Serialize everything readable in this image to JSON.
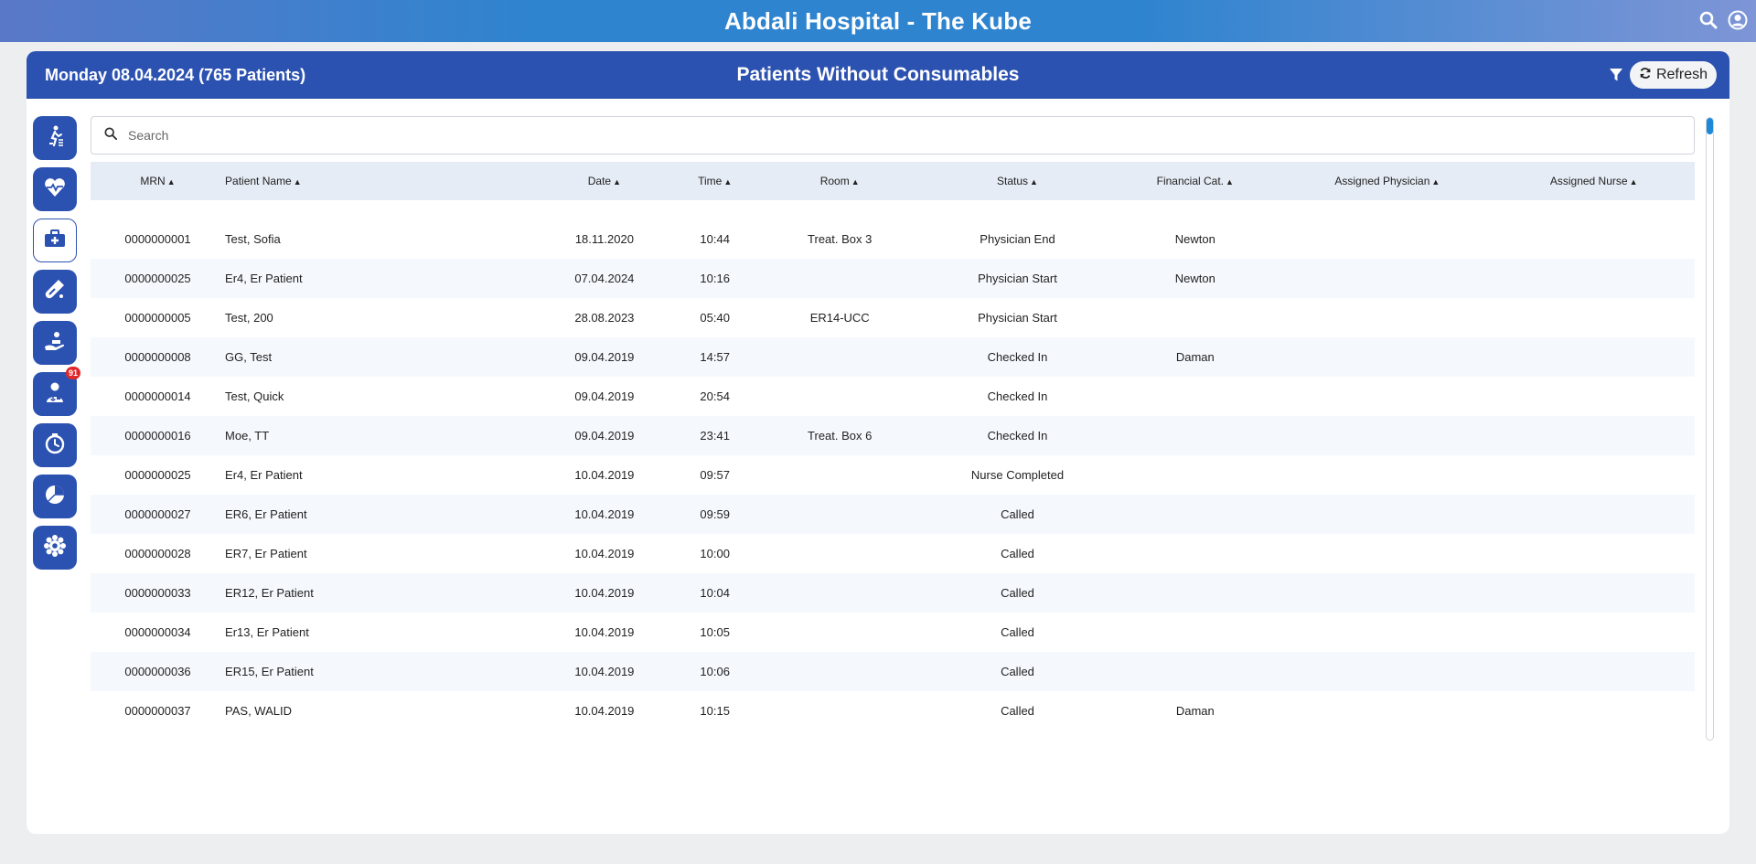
{
  "app": {
    "title": "Abdali Hospital - The Kube",
    "top_icons": [
      "search-icon",
      "user-account-icon"
    ]
  },
  "header": {
    "date_info": "Monday 08.04.2024 (765 Patients)",
    "page_title": "Patients Without Consumables",
    "refresh_label": "Refresh"
  },
  "sidebar": {
    "items": [
      {
        "icon": "patient-walking-icon"
      },
      {
        "icon": "heart-monitor-icon"
      },
      {
        "icon": "medical-kit-icon",
        "active": true
      },
      {
        "icon": "lab-test-tube-icon"
      },
      {
        "icon": "care-hand-icon"
      },
      {
        "icon": "doctor-icon",
        "badge": "91"
      },
      {
        "icon": "stopwatch-icon"
      },
      {
        "icon": "pie-chart-icon"
      },
      {
        "icon": "settings-gear-icon"
      }
    ]
  },
  "search": {
    "placeholder": "Search"
  },
  "table": {
    "columns": [
      "MRN",
      "Patient Name",
      "Date",
      "Time",
      "Room",
      "Status",
      "Financial Cat.",
      "Assigned Physician",
      "Assigned Nurse"
    ],
    "rows": [
      {
        "mrn": "0000000001",
        "name": "Test, Sofia",
        "date": "18.11.2020",
        "time": "10:44",
        "room": "Treat. Box 3",
        "status": "Physician End",
        "fin": "Newton",
        "physician": "",
        "nurse": ""
      },
      {
        "mrn": "0000000025",
        "name": "Er4, Er Patient",
        "date": "07.04.2024",
        "time": "10:16",
        "room": "",
        "status": "Physician Start",
        "fin": "Newton",
        "physician": "",
        "nurse": ""
      },
      {
        "mrn": "0000000005",
        "name": "Test, 200",
        "date": "28.08.2023",
        "time": "05:40",
        "room": "ER14-UCC",
        "status": "Physician Start",
        "fin": "",
        "physician": "",
        "nurse": ""
      },
      {
        "mrn": "0000000008",
        "name": "GG, Test",
        "date": "09.04.2019",
        "time": "14:57",
        "room": "",
        "status": "Checked In",
        "fin": "Daman",
        "physician": "",
        "nurse": ""
      },
      {
        "mrn": "0000000014",
        "name": "Test, Quick",
        "date": "09.04.2019",
        "time": "20:54",
        "room": "",
        "status": "Checked In",
        "fin": "",
        "physician": "",
        "nurse": ""
      },
      {
        "mrn": "0000000016",
        "name": "Moe, TT",
        "date": "09.04.2019",
        "time": "23:41",
        "room": "Treat. Box 6",
        "status": "Checked In",
        "fin": "",
        "physician": "",
        "nurse": ""
      },
      {
        "mrn": "0000000025",
        "name": "Er4, Er Patient",
        "date": "10.04.2019",
        "time": "09:57",
        "room": "",
        "status": "Nurse Completed",
        "fin": "",
        "physician": "",
        "nurse": ""
      },
      {
        "mrn": "0000000027",
        "name": "ER6, Er Patient",
        "date": "10.04.2019",
        "time": "09:59",
        "room": "",
        "status": "Called",
        "fin": "",
        "physician": "",
        "nurse": ""
      },
      {
        "mrn": "0000000028",
        "name": "ER7, Er Patient",
        "date": "10.04.2019",
        "time": "10:00",
        "room": "",
        "status": "Called",
        "fin": "",
        "physician": "",
        "nurse": ""
      },
      {
        "mrn": "0000000033",
        "name": "ER12, Er Patient",
        "date": "10.04.2019",
        "time": "10:04",
        "room": "",
        "status": "Called",
        "fin": "",
        "physician": "",
        "nurse": ""
      },
      {
        "mrn": "0000000034",
        "name": "Er13, Er Patient",
        "date": "10.04.2019",
        "time": "10:05",
        "room": "",
        "status": "Called",
        "fin": "",
        "physician": "",
        "nurse": ""
      },
      {
        "mrn": "0000000036",
        "name": "ER15, Er Patient",
        "date": "10.04.2019",
        "time": "10:06",
        "room": "",
        "status": "Called",
        "fin": "",
        "physician": "",
        "nurse": ""
      },
      {
        "mrn": "0000000037",
        "name": "PAS, WALID",
        "date": "10.04.2019",
        "time": "10:15",
        "room": "",
        "status": "Called",
        "fin": "Daman",
        "physician": "",
        "nurse": ""
      }
    ]
  }
}
